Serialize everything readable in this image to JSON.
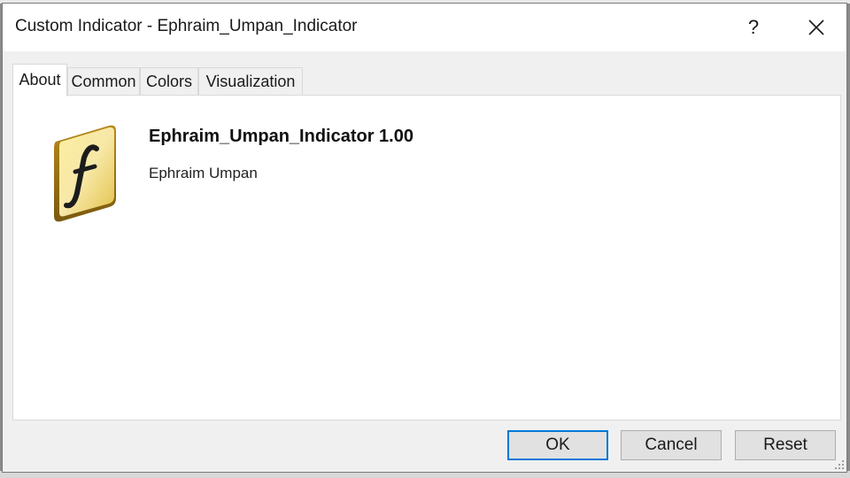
{
  "window": {
    "title": "Custom Indicator - Ephraim_Umpan_Indicator",
    "help_label": "?",
    "close_icon": "close-icon"
  },
  "tabs": [
    {
      "label": "About",
      "active": true
    },
    {
      "label": "Common",
      "active": false
    },
    {
      "label": "Colors",
      "active": false
    },
    {
      "label": "Visualization",
      "active": false
    }
  ],
  "about": {
    "icon": "function-f-icon",
    "name_version": "Ephraim_Umpan_Indicator 1.00",
    "author": "Ephraim Umpan"
  },
  "buttons": {
    "ok": "OK",
    "cancel": "Cancel",
    "reset": "Reset"
  },
  "colors": {
    "accent": "#0078d7",
    "icon_gold": "#e8c24a",
    "background_red_text": "#c0141c"
  }
}
